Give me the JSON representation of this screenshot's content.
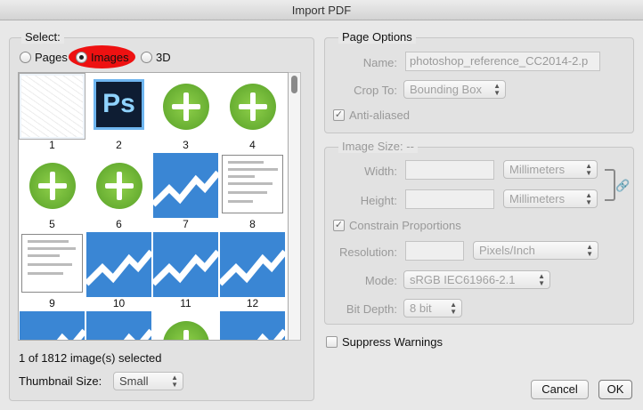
{
  "window": {
    "title": "Import PDF"
  },
  "select": {
    "label": "Select:",
    "options": [
      {
        "label": "Pages",
        "checked": false
      },
      {
        "label": "Images",
        "checked": true
      },
      {
        "label": "3D",
        "checked": false
      }
    ]
  },
  "thumbnails": [
    {
      "num": "1",
      "kind": "sketch",
      "selected": true
    },
    {
      "num": "2",
      "kind": "ps-icon",
      "text": "Ps"
    },
    {
      "num": "3",
      "kind": "green-plus"
    },
    {
      "num": "4",
      "kind": "green-plus"
    },
    {
      "num": "5",
      "kind": "green-plus"
    },
    {
      "num": "6",
      "kind": "green-plus"
    },
    {
      "num": "7",
      "kind": "blue-chart"
    },
    {
      "num": "8",
      "kind": "screenshot"
    },
    {
      "num": "9",
      "kind": "screenshot"
    },
    {
      "num": "10",
      "kind": "blue-chart"
    },
    {
      "num": "11",
      "kind": "blue-chart"
    },
    {
      "num": "12",
      "kind": "blue-chart"
    }
  ],
  "status": {
    "selected_text": "1 of 1812 image(s) selected"
  },
  "thumbnail_size": {
    "label": "Thumbnail Size:",
    "value": "Small"
  },
  "page_options": {
    "label": "Page Options",
    "name_label": "Name:",
    "name_value": "photoshop_reference_CC2014-2.p",
    "crop_label": "Crop To:",
    "crop_value": "Bounding Box",
    "anti_aliased_label": "Anti-aliased",
    "anti_aliased": true
  },
  "image_size": {
    "label": "Image Size: --",
    "width_label": "Width:",
    "width_unit": "Millimeters",
    "height_label": "Height:",
    "height_unit": "Millimeters",
    "constrain_label": "Constrain Proportions",
    "constrain": true,
    "resolution_label": "Resolution:",
    "resolution_unit": "Pixels/Inch",
    "mode_label": "Mode:",
    "mode_value": "sRGB IEC61966-2.1",
    "bitdepth_label": "Bit Depth:",
    "bitdepth_value": "8 bit"
  },
  "suppress": {
    "label": "Suppress Warnings",
    "checked": false
  },
  "buttons": {
    "cancel": "Cancel",
    "ok": "OK"
  },
  "colors": {
    "highlight": "#ee1111",
    "chart_blue": "#3a86d4",
    "plus_green": "#6cb834"
  }
}
